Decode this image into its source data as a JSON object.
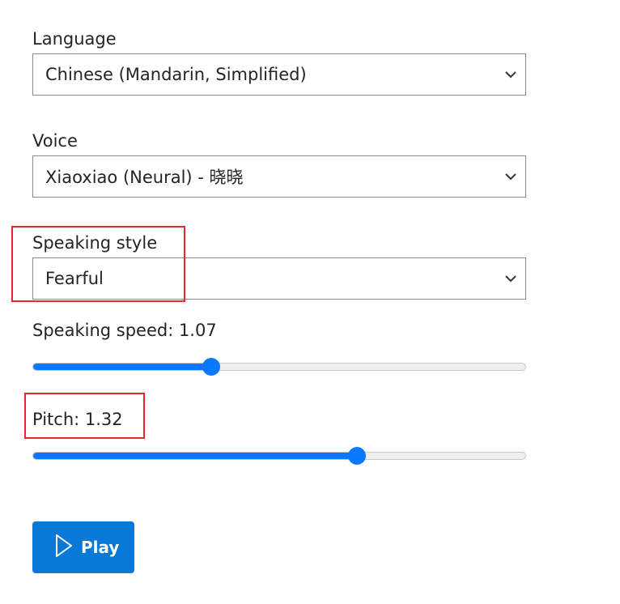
{
  "language": {
    "label": "Language",
    "selected": "Chinese (Mandarin, Simplified)"
  },
  "voice": {
    "label": "Voice",
    "selected": "Xiaoxiao (Neural) - 晓晓"
  },
  "speaking_style": {
    "label": "Speaking style",
    "selected": "Fearful"
  },
  "speaking_speed": {
    "label": "Speaking speed: 1.07",
    "value": 1.07,
    "fill_fraction": 0.363
  },
  "pitch": {
    "label": "Pitch: 1.32",
    "value": 1.32,
    "fill_fraction": 0.658
  },
  "play_button": {
    "label": "Play",
    "icon": "play-icon"
  },
  "colors": {
    "accent": "#0a78ff",
    "button": "#0a78d7",
    "highlight": "#e8262b"
  }
}
